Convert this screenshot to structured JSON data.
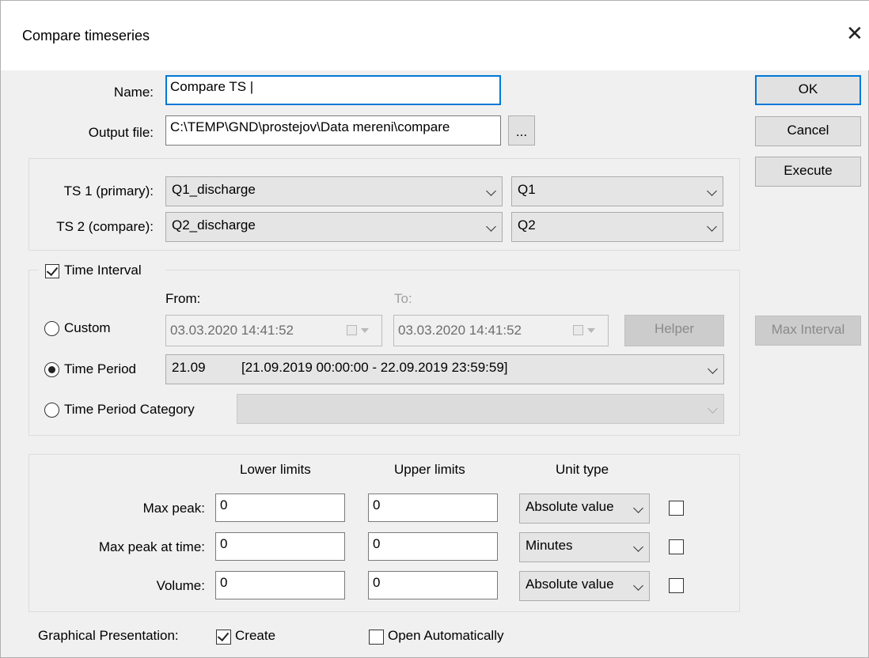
{
  "window": {
    "title": "Compare timeseries",
    "close_glyph": "✕"
  },
  "form": {
    "name_label": "Name:",
    "name_value": "Compare TS |",
    "output_label": "Output file:",
    "output_value": "C:\\TEMP\\GND\\prostejov\\Data mereni\\compare",
    "browse_label": "..."
  },
  "buttons": {
    "ok": "OK",
    "cancel": "Cancel",
    "execute": "Execute",
    "max_interval": "Max Interval"
  },
  "timeseries": {
    "ts1_label": "TS 1 (primary):",
    "ts1_value": "Q1_discharge",
    "ts1_var": "Q1",
    "ts2_label": "TS 2 (compare):",
    "ts2_value": "Q2_discharge",
    "ts2_var": "Q2"
  },
  "interval": {
    "checkbox_label": "Time Interval",
    "checked": true,
    "from_label": "From:",
    "to_label": "To:",
    "custom_label": "Custom",
    "from_value": "03.03.2020 14:41:52",
    "to_value": "03.03.2020 14:41:52",
    "helper_label": "Helper",
    "period_label": "Time Period",
    "period_code": "21.09",
    "period_range": "[21.09.2019 00:00:00 - 22.09.2019 23:59:59]",
    "category_label": "Time Period Category",
    "selected": "Time Period"
  },
  "limits": {
    "lower_header": "Lower limits",
    "upper_header": "Upper limits",
    "unit_header": "Unit type",
    "rows": [
      {
        "label": "Max peak:",
        "lower": "0",
        "upper": "0",
        "unit": "Absolute value",
        "checked": false
      },
      {
        "label": "Max peak at time:",
        "lower": "0",
        "upper": "0",
        "unit": "Minutes",
        "checked": false
      },
      {
        "label": "Volume:",
        "lower": "0",
        "upper": "0",
        "unit": "Absolute value",
        "checked": false
      }
    ]
  },
  "graphical": {
    "label": "Graphical Presentation:",
    "create_label": "Create",
    "create_checked": true,
    "open_label": "Open Automatically",
    "open_checked": false
  },
  "colors": {
    "accent": "#0078d7",
    "dialog_bg": "#f0f0f0"
  }
}
